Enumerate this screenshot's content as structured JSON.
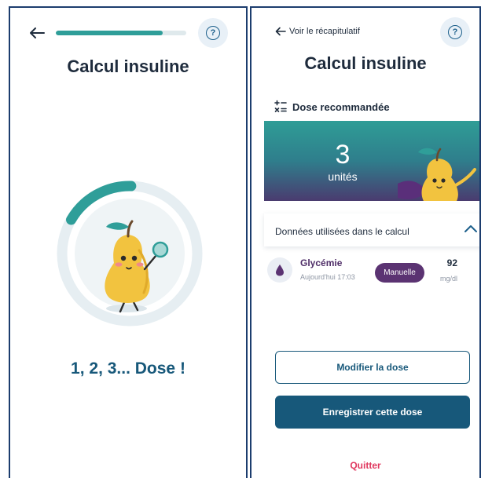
{
  "colors": {
    "accent_teal": "#2f9e99",
    "primary_blue": "#17587a",
    "badge_purple": "#5b3372",
    "quit_red": "#e0385f",
    "frame_border": "#1c3d6e"
  },
  "screen_left": {
    "back_icon": "arrow-left-icon",
    "progress_fraction": 0.82,
    "help_icon": "question-circle-icon",
    "help_glyph": "?",
    "title": "Calcul insuline",
    "loader_fraction": 0.17,
    "mascot": "pear-mascot-with-magnifier",
    "status_text": "1, 2, 3... Dose !"
  },
  "screen_right": {
    "back_link": "Voir le récapitulatif",
    "help_glyph": "?",
    "title": "Calcul insuline",
    "section_title": "Dose recommandée",
    "section_icon": "calculator-icon",
    "dose_value": "3",
    "dose_unit": "unités",
    "mascot": "pear-mascot-hero",
    "data_header": "Données utilisées dans le calcul",
    "data_header_icon": "chevron-up-icon",
    "glycemia": {
      "icon": "blood-drop-icon",
      "label": "Glycémie",
      "time": "Aujourd'hui 17:03",
      "badge": "Manuelle",
      "value": "92",
      "unit": "mg/dl"
    },
    "modify_button": "Modifier la dose",
    "save_button": "Enregistrer cette dose",
    "quit_link": "Quitter"
  }
}
